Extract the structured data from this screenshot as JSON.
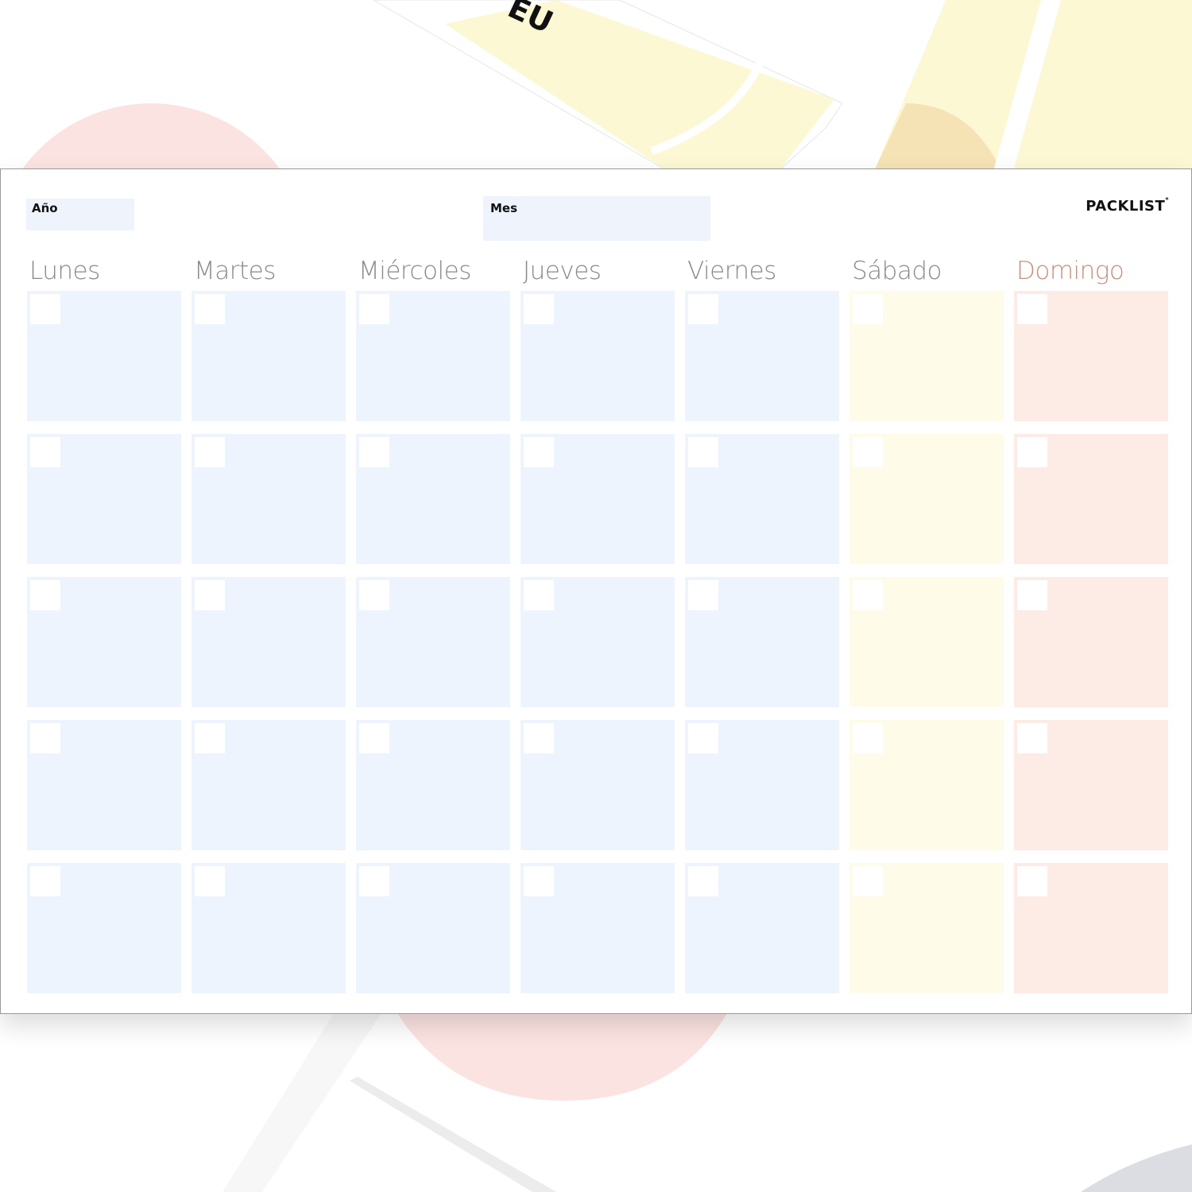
{
  "background": {
    "top_sheet_fragment_text": "EU"
  },
  "calendar": {
    "year_label": "Año",
    "month_label": "Mes",
    "brand": "PACKLIST",
    "brand_mark": "*",
    "days": [
      {
        "label": "Lunes",
        "kind": "weekday"
      },
      {
        "label": "Martes",
        "kind": "weekday"
      },
      {
        "label": "Miércoles",
        "kind": "weekday"
      },
      {
        "label": "Jueves",
        "kind": "weekday"
      },
      {
        "label": "Viernes",
        "kind": "weekday"
      },
      {
        "label": "Sábado",
        "kind": "saturday"
      },
      {
        "label": "Domingo",
        "kind": "sunday"
      }
    ],
    "week_rows": 5,
    "colors": {
      "weekday": "#eef4fd",
      "saturday": "#fefbe9",
      "sunday": "#fdebe5",
      "sunday_header": "#c68f7e"
    }
  }
}
